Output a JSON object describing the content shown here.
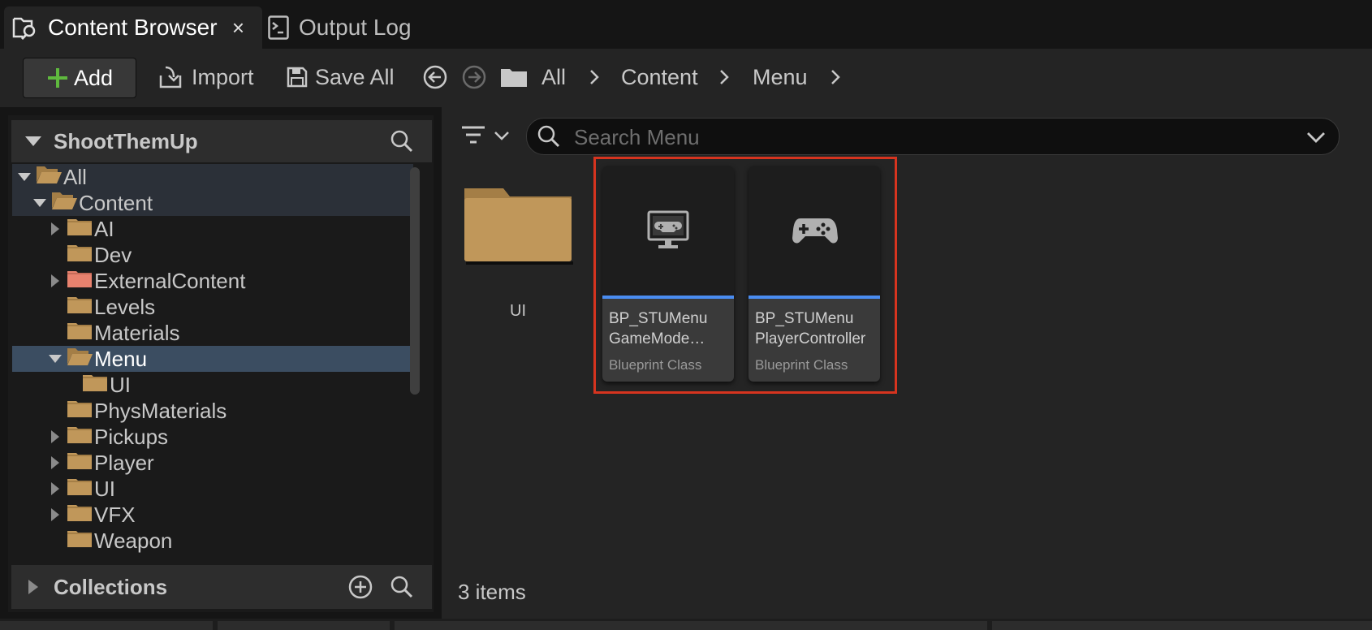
{
  "tabs": [
    {
      "label": "Content Browser",
      "close": "×"
    },
    {
      "label": "Output Log"
    }
  ],
  "toolbar": {
    "add_label": "Add",
    "import_label": "Import",
    "save_all_label": "Save All",
    "breadcrumb": [
      "All",
      "Content",
      "Menu"
    ]
  },
  "left_panel": {
    "title": "ShootThemUp",
    "collections_label": "Collections",
    "tree": [
      {
        "label": "All"
      },
      {
        "label": "Content"
      },
      {
        "label": "AI"
      },
      {
        "label": "Dev"
      },
      {
        "label": "ExternalContent"
      },
      {
        "label": "Levels"
      },
      {
        "label": "Materials"
      },
      {
        "label": "Menu"
      },
      {
        "label": "UI"
      },
      {
        "label": "PhysMaterials"
      },
      {
        "label": "Pickups"
      },
      {
        "label": "Player"
      },
      {
        "label": "UI"
      },
      {
        "label": "VFX"
      },
      {
        "label": "Weapon"
      }
    ]
  },
  "content": {
    "search_placeholder": "Search Menu",
    "items": [
      {
        "name": "UI",
        "type": "folder"
      },
      {
        "name": "BP_STUMenu\nGameMode…",
        "type": "Blueprint Class",
        "icon": "gamemode-monitor-icon"
      },
      {
        "name": "BP_STUMenu\nPlayerController",
        "type": "Blueprint Class",
        "icon": "gamepad-icon"
      }
    ],
    "item_count": "3 items"
  },
  "colors": {
    "selected_row": "#3b4d61",
    "asset_accent": "#4a8cf0",
    "highlight": "#d6341f",
    "folder": "#c0975a",
    "external_folder": "#e8826e",
    "add_icon": "#5fb93e"
  }
}
